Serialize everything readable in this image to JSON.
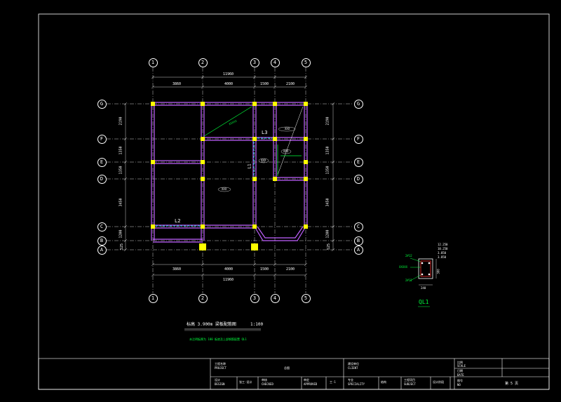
{
  "plan": {
    "axes_top": [
      "1",
      "2",
      "3",
      "4",
      "5"
    ],
    "axes_bottom": [
      "1",
      "2",
      "3",
      "4",
      "5"
    ],
    "axes_left": [
      "G",
      "F",
      "E",
      "D",
      "C",
      "B",
      "A"
    ],
    "axes_right": [
      "G",
      "F",
      "E",
      "D",
      "C",
      "B",
      "A"
    ],
    "dim_top_total": "11960",
    "dim_top_parts": [
      "3860",
      "4000",
      "1500",
      "2100"
    ],
    "dim_bottom_parts": [
      "3860",
      "4000",
      "1500",
      "2100"
    ],
    "dim_bottom_total": "11960",
    "dim_left_parts": [
      "2190",
      "1350",
      "1350",
      "3450",
      "1200",
      "525"
    ],
    "dim_right_parts": [
      "2190",
      "1350",
      "1350",
      "3450",
      "1200",
      "525"
    ],
    "beam_labels": {
      "l3": "L3",
      "l2": "L2",
      "l1": "L1"
    },
    "diag_label": "XXXXX",
    "slab_marks": [
      "XXX",
      "XXX",
      "XXX",
      "XXX"
    ]
  },
  "ql_detail": {
    "title": "QL1",
    "top_bar": "2#12",
    "side_note": "XXXXX",
    "bottom_bar": "2#12",
    "width": "240",
    "height": "300",
    "elev_1": "12.250",
    "elev_2": "10.250",
    "elev_3": "3.850",
    "elev_4": "3.850"
  },
  "caption": {
    "title": "标高  3.900m  梁板配筋图",
    "scale": "1:100",
    "note": "未注明板厚为   100  板底及上部钢筋配置     QL1"
  },
  "title_block": {
    "project_cn": "工程名称",
    "project_en": "PROJECT",
    "client_cn": "建设单位",
    "client_en": "CLIENT",
    "scale_cn": "比例",
    "scale_en": "SCALE",
    "date_cn": "日期",
    "date_en": "DATE",
    "sheet_cn": "图号",
    "sheet_en": "NO",
    "design_cn": "设计",
    "design_en": "DESIGN",
    "design_name": "张工·设计",
    "check_cn": "审核",
    "check_en": "CHECKED",
    "approve_cn": "审定",
    "approve_en": "APPROVED",
    "specialty_cn": "专业",
    "specialty_en": "SPECIALITY",
    "specialty_val": "结构",
    "subject_cn": "工程项目",
    "subject_en": "SUBJECT",
    "subject_val": "设计阶段",
    "drawing_label": "总图",
    "rev": "工·1",
    "page": "第 5 页"
  },
  "colors": {
    "background": "#000000",
    "line": "#ffffff",
    "beam": "#c060ff",
    "column": "#ffff00",
    "annotation": "#00ff3c",
    "dashed_beam": "#00c8c8"
  }
}
